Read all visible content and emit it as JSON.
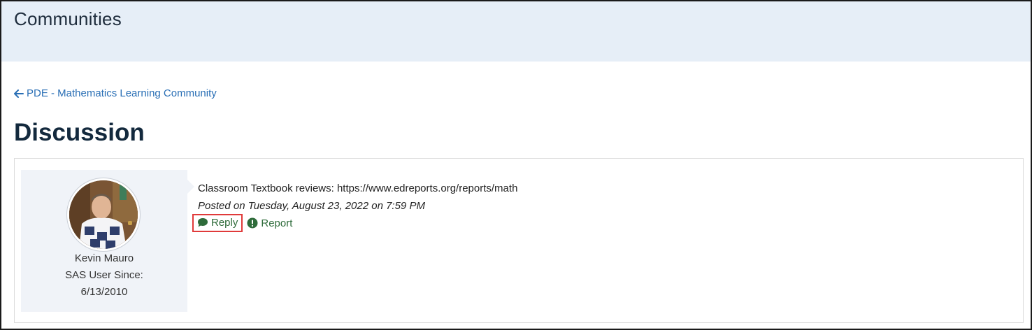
{
  "banner": {
    "title": "Communities"
  },
  "breadcrumb": {
    "back_label": "PDE - Mathematics Learning Community"
  },
  "page": {
    "title": "Discussion"
  },
  "post": {
    "author": {
      "name": "Kevin Mauro",
      "since_label": "SAS User Since:",
      "since_date": "6/13/2010"
    },
    "text": "Classroom Textbook reviews: https://www.edreports.org/reports/math",
    "posted": "Posted on Tuesday, August 23, 2022 on 7:59 PM",
    "actions": {
      "reply_label": "Reply",
      "report_label": "Report"
    }
  },
  "icons": {
    "back": "arrow-left-icon",
    "reply": "speech-bubble-icon",
    "report": "exclamation-circle-icon"
  },
  "colors": {
    "banner_bg": "#e6eef7",
    "link": "#2a6fb5",
    "action_green": "#2e6b3a",
    "highlight_red": "#e03a3a",
    "title": "#13293d"
  }
}
